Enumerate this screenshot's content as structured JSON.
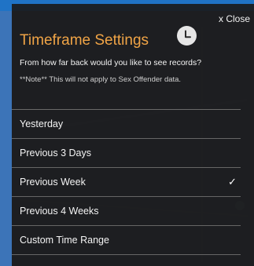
{
  "dialog": {
    "close_label": "x Close",
    "title": "Timeframe Settings",
    "question": "From how far back would you like to see records?",
    "note": "**Note** This will not apply to Sex Offender data."
  },
  "options": [
    {
      "label": "Yesterday",
      "selected": false
    },
    {
      "label": "Previous 3 Days",
      "selected": false
    },
    {
      "label": "Previous Week",
      "selected": true
    },
    {
      "label": "Previous 4 Weeks",
      "selected": false
    },
    {
      "label": "Custom Time Range",
      "selected": false
    }
  ],
  "icons": {
    "clock": "clock-icon",
    "selected": "checkmark-icon"
  },
  "colors": {
    "title": "#f0a446",
    "panel_background": "#1a1b1d",
    "top_bar": "#1f73c6",
    "side_strip": "#3c74b8"
  }
}
